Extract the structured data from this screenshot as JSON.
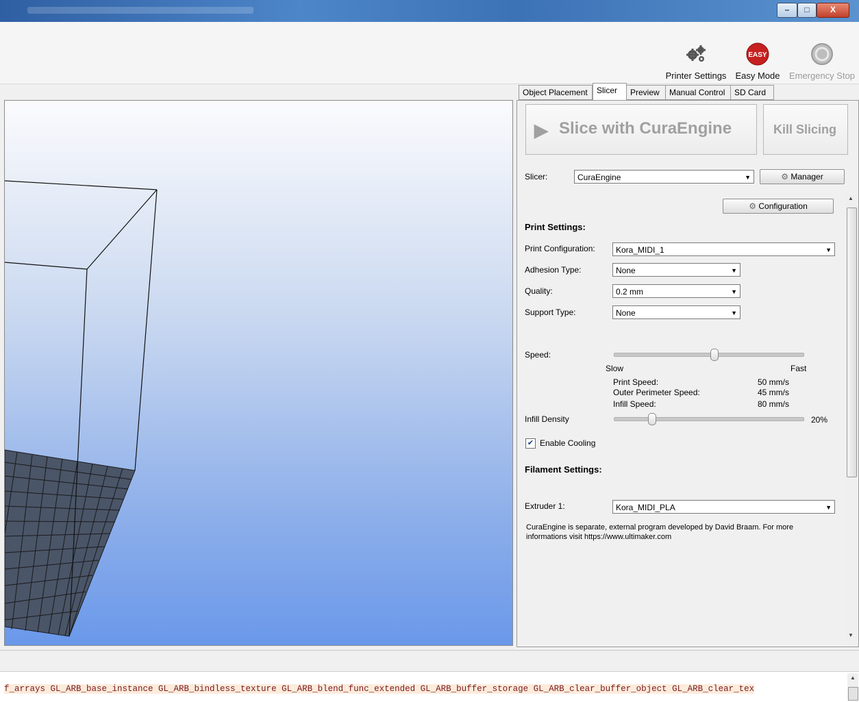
{
  "window": {
    "minimize_glyph": "–",
    "maximize_glyph": "□",
    "close_glyph": "X"
  },
  "toolbar": {
    "printer_settings": "Printer Settings",
    "easy_mode": "Easy Mode",
    "easy_badge": "EASY",
    "emergency_stop": "Emergency Stop"
  },
  "tabs": [
    "Object Placement",
    "Slicer",
    "Preview",
    "Manual Control",
    "SD Card"
  ],
  "slicer": {
    "slice_button": "Slice with CuraEngine",
    "kill_button": "Kill Slicing",
    "slicer_label": "Slicer:",
    "slicer_value": "CuraEngine",
    "manager_button": "Manager",
    "configuration_button": "Configuration",
    "print_settings_header": "Print Settings:",
    "print_config_label": "Print Configuration:",
    "print_config_value": "Kora_MIDI_1",
    "adhesion_label": "Adhesion Type:",
    "adhesion_value": "None",
    "quality_label": "Quality:",
    "quality_value": "0.2 mm",
    "support_label": "Support Type:",
    "support_value": "None",
    "speed_label": "Speed:",
    "speed_level": 0.53,
    "slow": "Slow",
    "fast": "Fast",
    "print_speed_label": "Print Speed:",
    "print_speed_value": "50 mm/s",
    "outer_perimeter_label": "Outer Perimeter Speed:",
    "outer_perimeter_value": "45 mm/s",
    "infill_speed_label": "Infill Speed:",
    "infill_speed_value": "80 mm/s",
    "infill_density_label": "Infill Density",
    "infill_density_value": "20%",
    "infill_density_level": 0.2,
    "enable_cooling_label": "Enable Cooling",
    "enable_cooling_checked": true,
    "filament_settings_header": "Filament Settings:",
    "extruder_label": "Extruder 1:",
    "extruder_value": "Kora_MIDI_PLA",
    "info_text": "CuraEngine is separate, external program developed by David Braam. For more informations visit https://www.ultimaker.com"
  },
  "log": {
    "text": "f_arrays GL_ARB_base_instance GL_ARB_bindless_texture GL_ARB_blend_func_extended GL_ARB_buffer_storage GL_ARB_clear_buffer_object GL_ARB_clear_tex"
  }
}
